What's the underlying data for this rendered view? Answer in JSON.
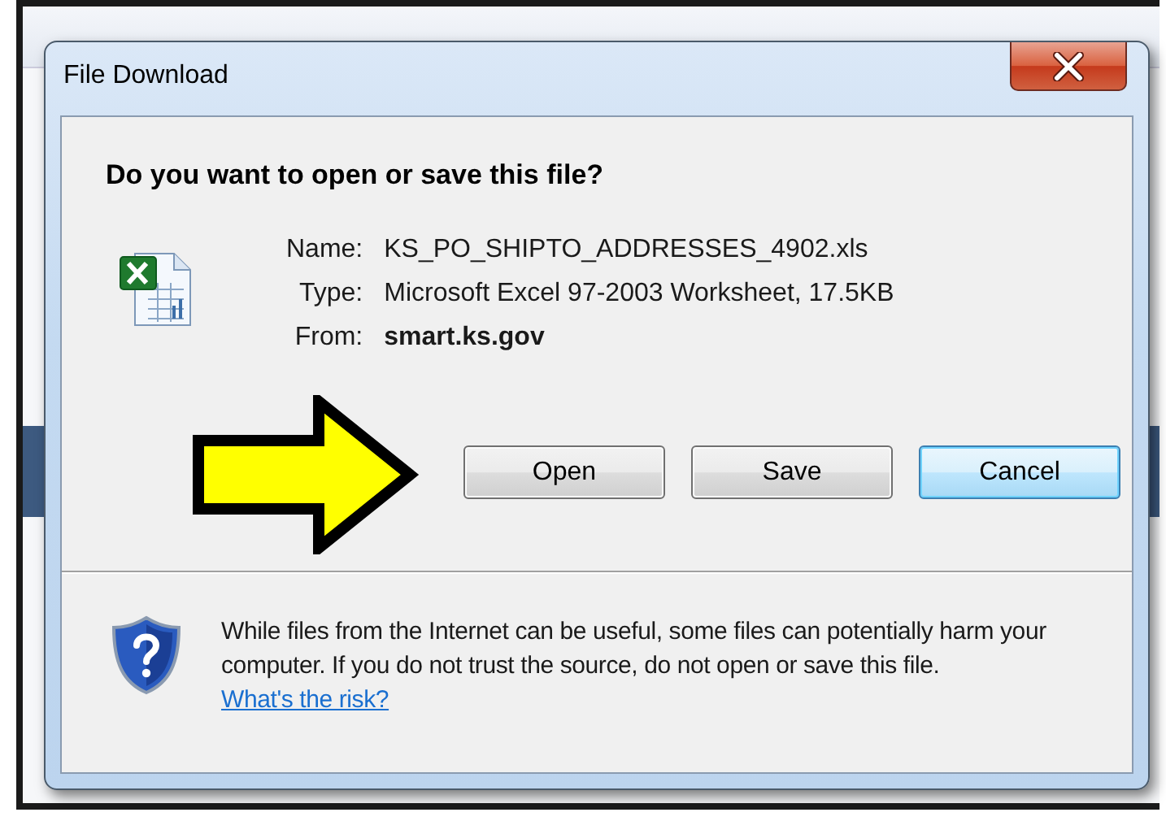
{
  "window": {
    "title": "File Download"
  },
  "question": "Do you want to open or save this file?",
  "fields": [
    {
      "label": "Name:",
      "value": "KS_PO_SHIPTO_ADDRESSES_4902.xls",
      "bold": false
    },
    {
      "label": "Type:",
      "value": "Microsoft Excel 97-2003 Worksheet, 17.5KB",
      "bold": false
    },
    {
      "label": "From:",
      "value": "smart.ks.gov",
      "bold": true
    }
  ],
  "buttons": [
    {
      "label": "Open",
      "default": false
    },
    {
      "label": "Save",
      "default": false
    },
    {
      "label": "Cancel",
      "default": true
    }
  ],
  "warning": {
    "text": "While files from the Internet can be useful, some files can potentially harm your computer. If you do not trust the source, do not open or save this file.",
    "link": "What's the risk?"
  }
}
